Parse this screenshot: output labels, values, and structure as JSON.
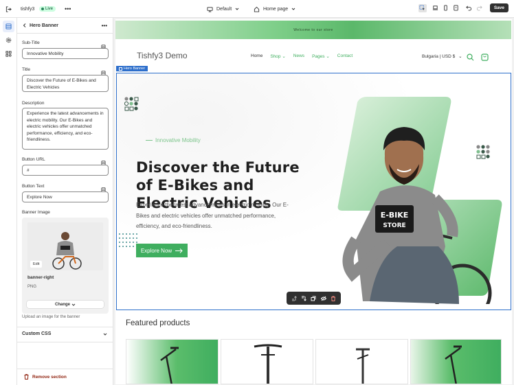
{
  "topbar": {
    "store_name": "tishfy3",
    "status": "Live",
    "theme": "Default",
    "page": "Home page",
    "save_label": "Save"
  },
  "panel": {
    "title": "Hero Banner",
    "fields": {
      "subtitle_label": "Sub-Title",
      "subtitle_value": "Innovative Mobility",
      "title_label": "Title",
      "title_value": "Discover the Future of E-Bikes and Electric Vehicles",
      "description_label": "Description",
      "description_value": "Experience the latest advancements in electric mobility. Our E-Bikes and electric vehicles offer unmatched performance, efficiency, and eco-friendliness.",
      "button_url_label": "Button URL",
      "button_url_value": "#",
      "button_text_label": "Button Text",
      "button_text_value": "Explore Now",
      "banner_image_label": "Banner Image"
    },
    "image": {
      "edit_label": "Edit",
      "file_name": "banner-right",
      "file_type": "PNG",
      "change_label": "Change",
      "help_text": "Upload an image for the banner"
    },
    "custom_css_label": "Custom CSS",
    "remove_label": "Remove section"
  },
  "preview": {
    "announcement": "Welcome to our store",
    "brand": "Tishfy3 Demo",
    "nav": [
      "Home",
      "Shop",
      "News",
      "Pages",
      "Contact"
    ],
    "currency": "Bulgaria | USD $",
    "section_tag": "Hero Banner",
    "hero": {
      "subtitle": "Innovative Mobility",
      "title": "Discover the Future of E-Bikes and Electric Vehicles",
      "description": "Experience the latest advancements in electric mobility. Our E-Bikes and electric vehicles offer unmatched performance, efficiency, and eco-friendliness.",
      "button": "Explore Now",
      "shirt_text": "E-BIKE STORE"
    },
    "featured_title": "Featured products"
  },
  "colors": {
    "accent_green": "#3fae5f",
    "selection_blue": "#2c6ecb",
    "danger": "#8e1f0b"
  },
  "icons": [
    "exit-icon",
    "more-icon",
    "desktop-icon",
    "home-icon",
    "inspector-icon",
    "laptop-icon",
    "mobile-icon",
    "tablet-icon",
    "undo-icon",
    "redo-icon",
    "sections-icon",
    "settings-icon",
    "apps-icon",
    "back-icon",
    "database-icon",
    "chevron-down-icon",
    "trash-icon",
    "search-icon",
    "cart-icon",
    "arrow-right-icon"
  ]
}
